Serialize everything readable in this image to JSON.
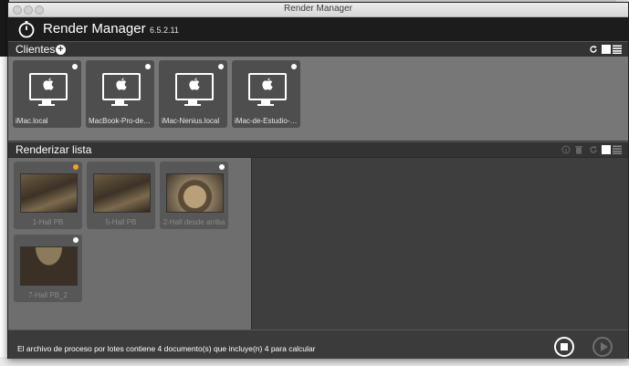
{
  "window": {
    "title": "Render Manager"
  },
  "app": {
    "name": "Render Manager",
    "version": "6.5.2.11"
  },
  "clients": {
    "title": "Clientes",
    "items": [
      {
        "label": "iMac.local"
      },
      {
        "label": "MacBook-Pro-de-Ne..."
      },
      {
        "label": "iMac-Nenius.local"
      },
      {
        "label": "iMac-de-Estudio-2.l..."
      }
    ]
  },
  "render_list": {
    "title": "Renderizar lista",
    "items": [
      {
        "label": "1-Hall PB",
        "status": "orange"
      },
      {
        "label": "5-Hall PB",
        "status": "none"
      },
      {
        "label": "2-Hall desde arriba",
        "status": "white"
      },
      {
        "label": "7-Hall PB_2",
        "status": "white"
      }
    ]
  },
  "status": {
    "text": "El archivo de proceso por lotes contiene 4 documento(s) que incluye(n) 4 para calcular"
  },
  "icons": {
    "add": "plus-circle-icon",
    "refresh": "refresh-icon",
    "grid_view": "grid-view-icon",
    "list_view": "list-view-icon",
    "stop": "stop-icon",
    "play": "play-icon",
    "stopwatch": "stopwatch-icon",
    "apple": "apple-icon"
  },
  "colors": {
    "accent_orange": "#f0a032",
    "header_bg": "#1c1c1c",
    "panel_bg": "#777777"
  }
}
